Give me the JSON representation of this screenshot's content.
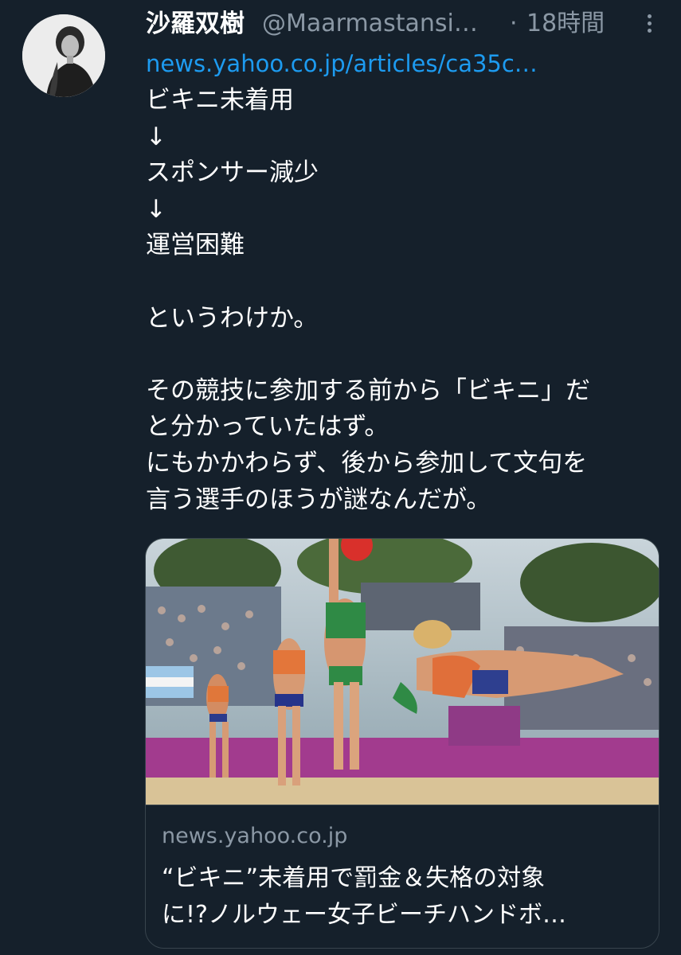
{
  "tweet": {
    "author_name": "沙羅双樹",
    "author_handle": "@Maarmastansi…",
    "separator": "·",
    "time": "18時間",
    "link": "news.yahoo.co.jp/articles/ca35c…",
    "text": "ビキニ未着用\n↓\nスポンサー減少\n↓\n運営困難\n\nというわけか。\n\nその競技に参加する前から「ビキニ」だ\nと分かっていたはず。\nにもかかわらず、後から参加して文句を\n言う選手のほうが謎なんだが。"
  },
  "card": {
    "domain": "news.yahoo.co.jp",
    "title": "“ビキニ”未着用で罰金＆失格の対象\nに!?ノルウェー女子ビーチハンドボ…"
  },
  "icons": {
    "more": "more-vertical-icon"
  },
  "colors": {
    "background": "#15202b",
    "link": "#1d9bf0",
    "secondary_text": "#8b98a5",
    "border": "#38444d"
  }
}
